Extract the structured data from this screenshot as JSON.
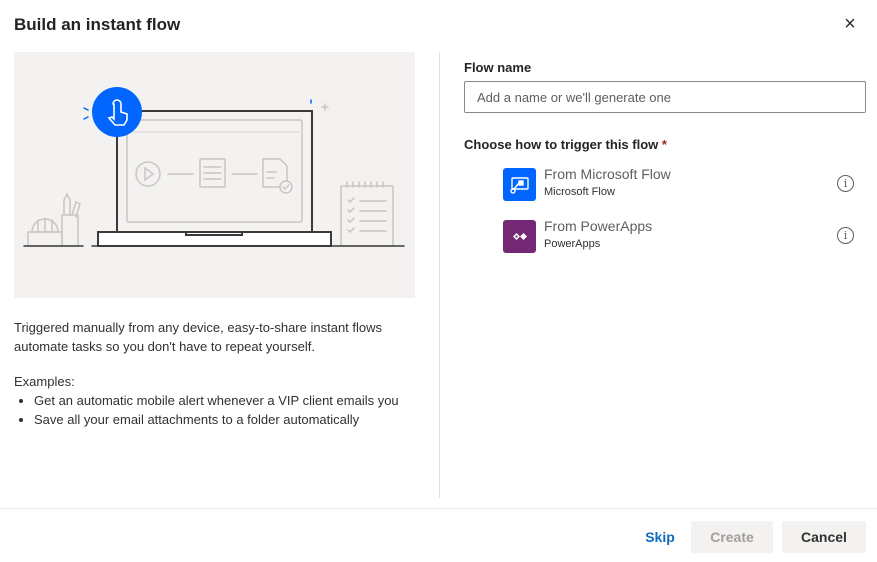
{
  "dialog": {
    "title": "Build an instant flow",
    "close_icon": "×"
  },
  "left": {
    "description": "Triggered manually from any device, easy-to-share instant flows automate tasks so you don't have to repeat yourself.",
    "examples_label": "Examples:",
    "examples": [
      "Get an automatic mobile alert whenever a VIP client emails you",
      "Save all your email attachments to a folder automatically"
    ]
  },
  "right": {
    "flow_name_label": "Flow name",
    "flow_name_value": "",
    "flow_name_placeholder": "Add a name or we'll generate one",
    "trigger_label": "Choose how to trigger this flow",
    "required_mark": "*",
    "options": [
      {
        "title": "From Microsoft Flow",
        "subtitle": "Microsoft Flow",
        "color": "#0066ff"
      },
      {
        "title": "From PowerApps",
        "subtitle": "PowerApps",
        "color": "#742774"
      }
    ],
    "info_icon": "i"
  },
  "footer": {
    "skip": "Skip",
    "create": "Create",
    "cancel": "Cancel"
  },
  "colors": {
    "accent": "#0f6cbd",
    "illustration_blue": "#0066ff"
  }
}
